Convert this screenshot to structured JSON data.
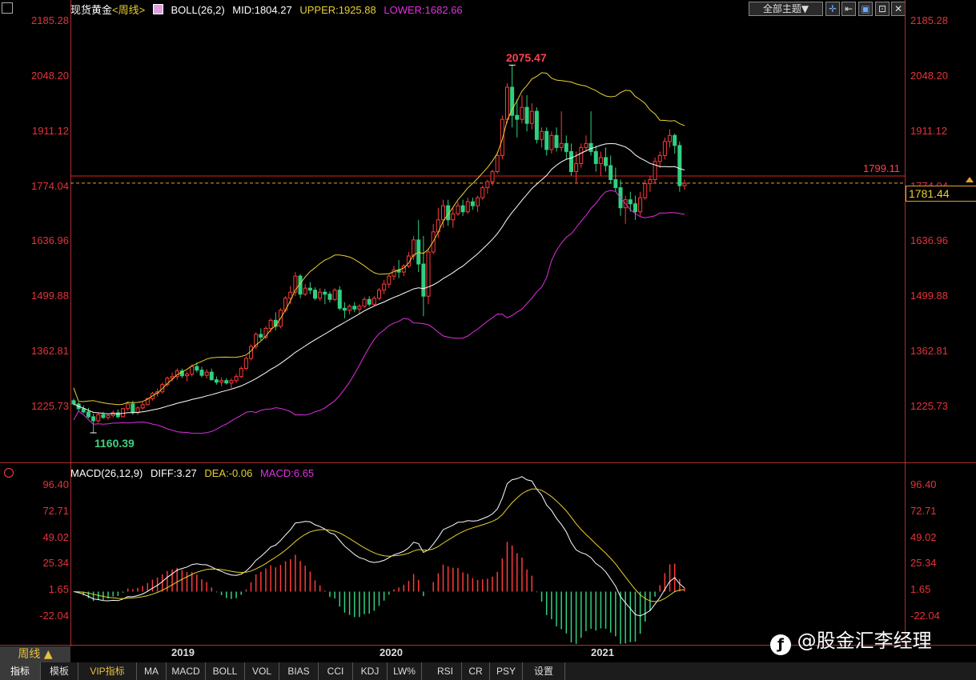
{
  "header": {
    "symbol": "现货黄金",
    "period": "<周线>",
    "indicator_name": "BOLL(26,2)",
    "mid": "MID:1804.27",
    "upper": "UPPER:1925.88",
    "lower": "LOWER:1682.66",
    "theme_button": "全部主题▼",
    "colors": {
      "mid": "#ffffff",
      "upper": "#e8d030",
      "lower": "#e030e0"
    }
  },
  "macd_header": {
    "name": "MACD(26,12,9)",
    "diff": "DIFF:3.27",
    "dea": "DEA:-0.06",
    "macd": "MACD:6.65"
  },
  "price_axis": {
    "ticks": [
      "2185.28",
      "2048.20",
      "1911.12",
      "1774.04",
      "1636.96",
      "1499.88",
      "1362.81",
      "1225.73"
    ],
    "values": [
      2185.28,
      2048.2,
      1911.12,
      1774.04,
      1636.96,
      1499.88,
      1362.81,
      1225.73
    ]
  },
  "macd_axis": {
    "ticks": [
      "96.40",
      "72.71",
      "49.02",
      "25.34",
      "1.65",
      "-22.04"
    ],
    "values": [
      96.4,
      72.71,
      49.02,
      25.34,
      1.65,
      -22.04
    ]
  },
  "annotations": {
    "high_label": "2075.47",
    "low_label": "1160.39",
    "line_label": "1799.11",
    "current_price": "1781.44"
  },
  "x_labels": [
    "2019",
    "2020",
    "2021"
  ],
  "period_button": "周线 ▲",
  "tabs": [
    "指标",
    "模板",
    "VIP指标",
    "MA",
    "MACD",
    "BOLL",
    "VOL",
    "BIAS",
    "CCI",
    "KDJ",
    "LW%",
    "RSI",
    "CR",
    "PSY",
    "设置"
  ],
  "watermark": "@股金汇李经理",
  "chart_data": {
    "type": "candlestick",
    "title": "现货黄金 周线",
    "ylim": [
      1100,
      2185.28
    ],
    "candles": [
      [
        1240,
        1245,
        1228,
        1232
      ],
      [
        1232,
        1236,
        1215,
        1220
      ],
      [
        1220,
        1228,
        1208,
        1212
      ],
      [
        1212,
        1222,
        1196,
        1200
      ],
      [
        1200,
        1208,
        1160,
        1190
      ],
      [
        1190,
        1210,
        1185,
        1205
      ],
      [
        1205,
        1212,
        1195,
        1198
      ],
      [
        1198,
        1206,
        1192,
        1203
      ],
      [
        1203,
        1215,
        1198,
        1210
      ],
      [
        1210,
        1218,
        1196,
        1200
      ],
      [
        1200,
        1222,
        1198,
        1220
      ],
      [
        1220,
        1238,
        1215,
        1232
      ],
      [
        1232,
        1240,
        1205,
        1210
      ],
      [
        1210,
        1226,
        1205,
        1222
      ],
      [
        1222,
        1236,
        1218,
        1230
      ],
      [
        1230,
        1248,
        1228,
        1245
      ],
      [
        1245,
        1262,
        1240,
        1258
      ],
      [
        1258,
        1270,
        1250,
        1262
      ],
      [
        1262,
        1285,
        1258,
        1280
      ],
      [
        1280,
        1300,
        1275,
        1296
      ],
      [
        1296,
        1310,
        1288,
        1300
      ],
      [
        1300,
        1320,
        1292,
        1314
      ],
      [
        1314,
        1320,
        1296,
        1302
      ],
      [
        1302,
        1312,
        1288,
        1306
      ],
      [
        1306,
        1330,
        1300,
        1325
      ],
      [
        1325,
        1335,
        1310,
        1316
      ],
      [
        1316,
        1324,
        1298,
        1303
      ],
      [
        1303,
        1318,
        1295,
        1311
      ],
      [
        1311,
        1320,
        1290,
        1292
      ],
      [
        1292,
        1300,
        1280,
        1286
      ],
      [
        1286,
        1298,
        1276,
        1290
      ],
      [
        1290,
        1296,
        1280,
        1284
      ],
      [
        1284,
        1295,
        1272,
        1290
      ],
      [
        1290,
        1306,
        1284,
        1300
      ],
      [
        1300,
        1325,
        1296,
        1320
      ],
      [
        1320,
        1350,
        1316,
        1345
      ],
      [
        1345,
        1380,
        1340,
        1375
      ],
      [
        1375,
        1410,
        1368,
        1405
      ],
      [
        1405,
        1420,
        1390,
        1398
      ],
      [
        1398,
        1425,
        1392,
        1420
      ],
      [
        1420,
        1445,
        1410,
        1440
      ],
      [
        1440,
        1460,
        1415,
        1425
      ],
      [
        1425,
        1470,
        1420,
        1465
      ],
      [
        1465,
        1500,
        1460,
        1495
      ],
      [
        1495,
        1525,
        1480,
        1510
      ],
      [
        1510,
        1560,
        1500,
        1550
      ],
      [
        1550,
        1555,
        1495,
        1505
      ],
      [
        1505,
        1530,
        1500,
        1520
      ],
      [
        1520,
        1535,
        1505,
        1515
      ],
      [
        1515,
        1522,
        1490,
        1495
      ],
      [
        1495,
        1520,
        1488,
        1510
      ],
      [
        1510,
        1518,
        1480,
        1505
      ],
      [
        1505,
        1512,
        1484,
        1492
      ],
      [
        1492,
        1520,
        1488,
        1515
      ],
      [
        1515,
        1525,
        1465,
        1470
      ],
      [
        1470,
        1485,
        1445,
        1465
      ],
      [
        1465,
        1480,
        1455,
        1475
      ],
      [
        1475,
        1485,
        1460,
        1468
      ],
      [
        1468,
        1480,
        1455,
        1475
      ],
      [
        1475,
        1498,
        1470,
        1492
      ],
      [
        1492,
        1500,
        1475,
        1480
      ],
      [
        1480,
        1500,
        1476,
        1495
      ],
      [
        1495,
        1520,
        1490,
        1515
      ],
      [
        1515,
        1540,
        1505,
        1530
      ],
      [
        1530,
        1555,
        1520,
        1550
      ],
      [
        1550,
        1575,
        1540,
        1565
      ],
      [
        1565,
        1590,
        1545,
        1560
      ],
      [
        1560,
        1580,
        1550,
        1575
      ],
      [
        1575,
        1610,
        1570,
        1600
      ],
      [
        1600,
        1650,
        1590,
        1640
      ],
      [
        1640,
        1690,
        1560,
        1580
      ],
      [
        1580,
        1650,
        1450,
        1500
      ],
      [
        1500,
        1620,
        1480,
        1610
      ],
      [
        1610,
        1680,
        1605,
        1660
      ],
      [
        1660,
        1720,
        1645,
        1690
      ],
      [
        1690,
        1740,
        1670,
        1725
      ],
      [
        1725,
        1740,
        1675,
        1690
      ],
      [
        1690,
        1720,
        1670,
        1705
      ],
      [
        1705,
        1735,
        1700,
        1725
      ],
      [
        1725,
        1740,
        1700,
        1710
      ],
      [
        1710,
        1745,
        1705,
        1735
      ],
      [
        1735,
        1745,
        1715,
        1725
      ],
      [
        1725,
        1750,
        1710,
        1745
      ],
      [
        1745,
        1775,
        1740,
        1770
      ],
      [
        1770,
        1790,
        1755,
        1785
      ],
      [
        1785,
        1815,
        1775,
        1810
      ],
      [
        1810,
        1860,
        1805,
        1850
      ],
      [
        1850,
        1950,
        1840,
        1940
      ],
      [
        1940,
        2030,
        1930,
        2020
      ],
      [
        2020,
        2075,
        1920,
        1950
      ],
      [
        1950,
        1990,
        1895,
        1940
      ],
      [
        1940,
        2000,
        1930,
        1970
      ],
      [
        1970,
        2000,
        1910,
        1930
      ],
      [
        1930,
        1980,
        1915,
        1960
      ],
      [
        1960,
        1970,
        1880,
        1890
      ],
      [
        1890,
        1920,
        1870,
        1910
      ],
      [
        1910,
        1920,
        1850,
        1865
      ],
      [
        1865,
        1910,
        1855,
        1900
      ],
      [
        1900,
        1920,
        1860,
        1870
      ],
      [
        1870,
        1960,
        1860,
        1880
      ],
      [
        1880,
        1900,
        1840,
        1860
      ],
      [
        1860,
        1880,
        1800,
        1810
      ],
      [
        1810,
        1860,
        1780,
        1830
      ],
      [
        1830,
        1880,
        1820,
        1870
      ],
      [
        1870,
        1900,
        1860,
        1880
      ],
      [
        1880,
        1960,
        1850,
        1860
      ],
      [
        1860,
        1875,
        1810,
        1830
      ],
      [
        1830,
        1860,
        1800,
        1845
      ],
      [
        1845,
        1870,
        1810,
        1825
      ],
      [
        1825,
        1850,
        1780,
        1790
      ],
      [
        1790,
        1820,
        1760,
        1770
      ],
      [
        1770,
        1790,
        1700,
        1720
      ],
      [
        1720,
        1750,
        1680,
        1740
      ],
      [
        1740,
        1760,
        1710,
        1730
      ],
      [
        1730,
        1750,
        1690,
        1710
      ],
      [
        1710,
        1760,
        1700,
        1745
      ],
      [
        1745,
        1790,
        1740,
        1780
      ],
      [
        1780,
        1800,
        1760,
        1790
      ],
      [
        1790,
        1845,
        1780,
        1835
      ],
      [
        1835,
        1860,
        1820,
        1850
      ],
      [
        1850,
        1895,
        1840,
        1885
      ],
      [
        1885,
        1915,
        1870,
        1900
      ],
      [
        1900,
        1905,
        1855,
        1875
      ],
      [
        1875,
        1885,
        1760,
        1775
      ],
      [
        1775,
        1790,
        1765,
        1781
      ]
    ]
  }
}
